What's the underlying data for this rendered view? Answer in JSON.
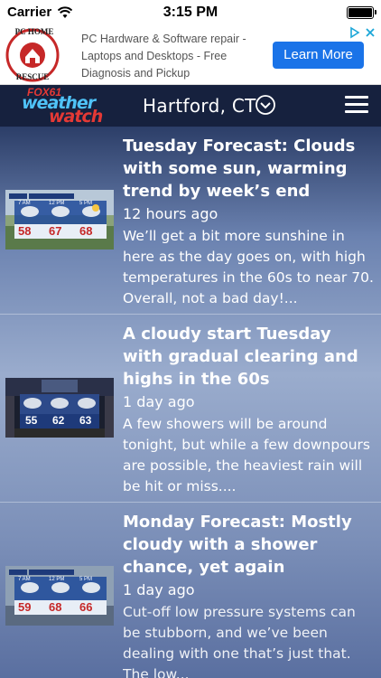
{
  "status_bar": {
    "carrier": "Carrier",
    "time": "3:15 PM",
    "icons": [
      "wifi-icon",
      "battery-icon"
    ]
  },
  "ad": {
    "logo_top": "PC HOME",
    "logo_bottom": "RESCUE",
    "text": "PC Hardware & Software repair - Laptops and Desktops - Free Diagnosis and Pickup",
    "cta": "Learn More",
    "icons": [
      "adchoices-icon",
      "close-icon"
    ]
  },
  "header": {
    "logo_line1": "FOX61",
    "logo_line2": "weather",
    "logo_line3": "watch",
    "city": "Hartford, CT",
    "icons": [
      "chevron-down-icon",
      "menu-icon"
    ]
  },
  "articles": [
    {
      "title": "Tuesday Forecast: Clouds with some sun, warming trend by week’s end",
      "time": "12 hours ago",
      "summary": "We’ll get a bit more sunshine in here as the day goes on, with high temperatures in the 60s to near 70. Overall, not a bad day!...",
      "thumb": {
        "labels": [
          "7 AM",
          "12 PM",
          "5 PM"
        ],
        "temps": [
          "58",
          "67",
          "68"
        ]
      }
    },
    {
      "title": "A cloudy start Tuesday with gradual clearing and highs in the 60s",
      "time": "1 day ago",
      "summary": "A few showers will be around tonight, but while a few downpours are possible, the heaviest rain will be hit or miss....",
      "thumb": {
        "labels": [
          "7 AM",
          "12 PM",
          "5 PM"
        ],
        "temps": [
          "55",
          "62",
          "63"
        ]
      }
    },
    {
      "title": "Monday Forecast: Mostly cloudy with a shower chance, yet again",
      "time": "1 day ago",
      "summary": "Cut-off low pressure systems can be stubborn, and we’ve been dealing with one that’s just that. The low...",
      "thumb": {
        "labels": [
          "7 AM",
          "12 PM",
          "5 PM"
        ],
        "temps": [
          "59",
          "68",
          "66"
        ]
      }
    }
  ]
}
